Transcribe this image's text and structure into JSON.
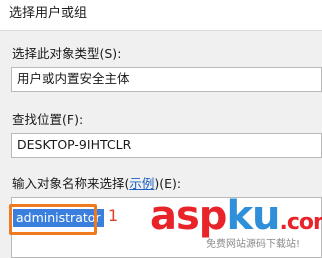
{
  "window": {
    "title": "选择用户或组"
  },
  "object_type": {
    "label": "选择此对象类型(S):",
    "value": "用户或内置安全主体"
  },
  "location": {
    "label": "查找位置(F):",
    "value": "DESKTOP-9IHTCLR"
  },
  "object_names": {
    "label_prefix": "输入对象名称来选择(",
    "label_link": "示例",
    "label_suffix": ")(E):",
    "value": "administrator"
  },
  "annotation": {
    "step": "1",
    "color": "#f07a1e",
    "step_color": "#e23f28"
  },
  "watermark": {
    "part_a": "asp",
    "part_b": "ku",
    "part_c": ".com",
    "color_a": "#e8232a",
    "color_b": "#2f8fd8",
    "subtitle": "免费网站源码下载站!"
  }
}
